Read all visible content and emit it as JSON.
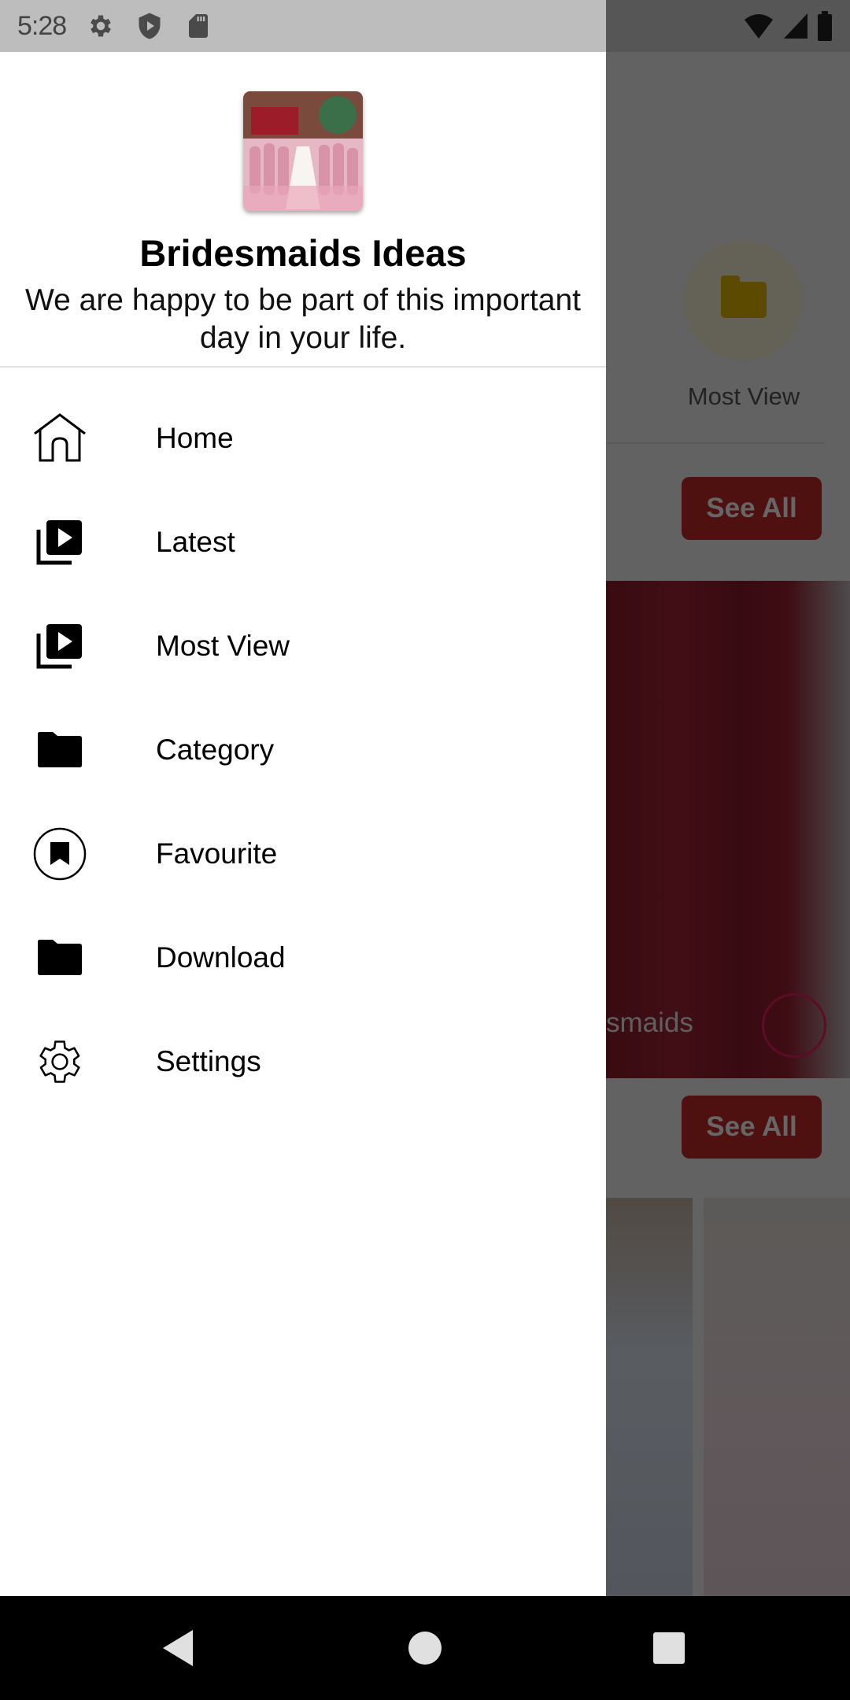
{
  "status_bar": {
    "time": "5:28",
    "left_icons": [
      "gear-icon",
      "shield-play-icon",
      "sd-card-icon"
    ],
    "right_icons": [
      "wifi-icon",
      "cell-signal-icon",
      "battery-icon"
    ]
  },
  "drawer": {
    "header": {
      "app_title": "Bridesmaids Ideas",
      "app_subtitle": "We are happy to be part of this important day in your life."
    },
    "menu_items": [
      {
        "label": "Home",
        "icon": "home-icon"
      },
      {
        "label": "Latest",
        "icon": "video-library-icon"
      },
      {
        "label": "Most View",
        "icon": "video-library-icon"
      },
      {
        "label": "Category",
        "icon": "folder-icon"
      },
      {
        "label": "Favourite",
        "icon": "bookmark-circle-icon"
      },
      {
        "label": "Download",
        "icon": "folder-icon"
      },
      {
        "label": "Settings",
        "icon": "gear-icon"
      }
    ]
  },
  "background": {
    "category_label": "Most View",
    "see_all_label": "See All",
    "photo_caption_partial": "smaids",
    "colors": {
      "accent_red": "#c62828",
      "category_yellow": "#e5b800",
      "bookmark_pink": "#e91e63"
    }
  },
  "nav_bar": {
    "buttons": [
      "back",
      "home",
      "recents"
    ]
  }
}
